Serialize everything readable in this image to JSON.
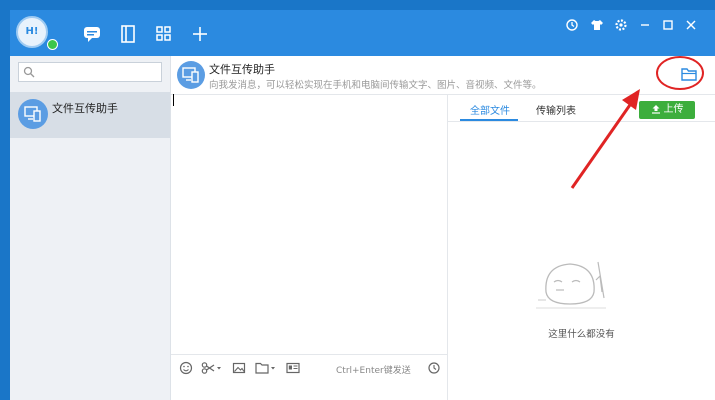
{
  "titlebar": {
    "avatar_text": "H!",
    "nav_icons": [
      "chat-bubble-icon",
      "contacts-book-icon",
      "apps-grid-icon",
      "plus-icon"
    ],
    "window_icons": [
      "history-icon",
      "skin-shirt-icon",
      "gear-icon",
      "minimize-icon",
      "maximize-icon",
      "close-icon"
    ]
  },
  "sidebar": {
    "search_placeholder": "",
    "contacts": [
      {
        "name": "文件互传助手"
      }
    ]
  },
  "chat_header": {
    "title": "文件互传助手",
    "subtitle": "向我发消息，可以轻松实现在手机和电脑间传输文字、图片、音视频、文件等。"
  },
  "chat": {
    "toolbar_icons": [
      "emoji-icon",
      "scissors-icon",
      "image-icon",
      "folder-icon",
      "card-icon",
      "history-icon"
    ],
    "send_hint": "Ctrl+Enter键发送"
  },
  "files_panel": {
    "tabs": [
      {
        "label": "全部文件",
        "active": true
      },
      {
        "label": "传输列表",
        "active": false
      }
    ],
    "upload_label": "上传",
    "empty_text": "这里什么都没有"
  },
  "colors": {
    "accent": "#2b8ae0",
    "upload": "#3cae3c",
    "annotation": "#e02424"
  }
}
